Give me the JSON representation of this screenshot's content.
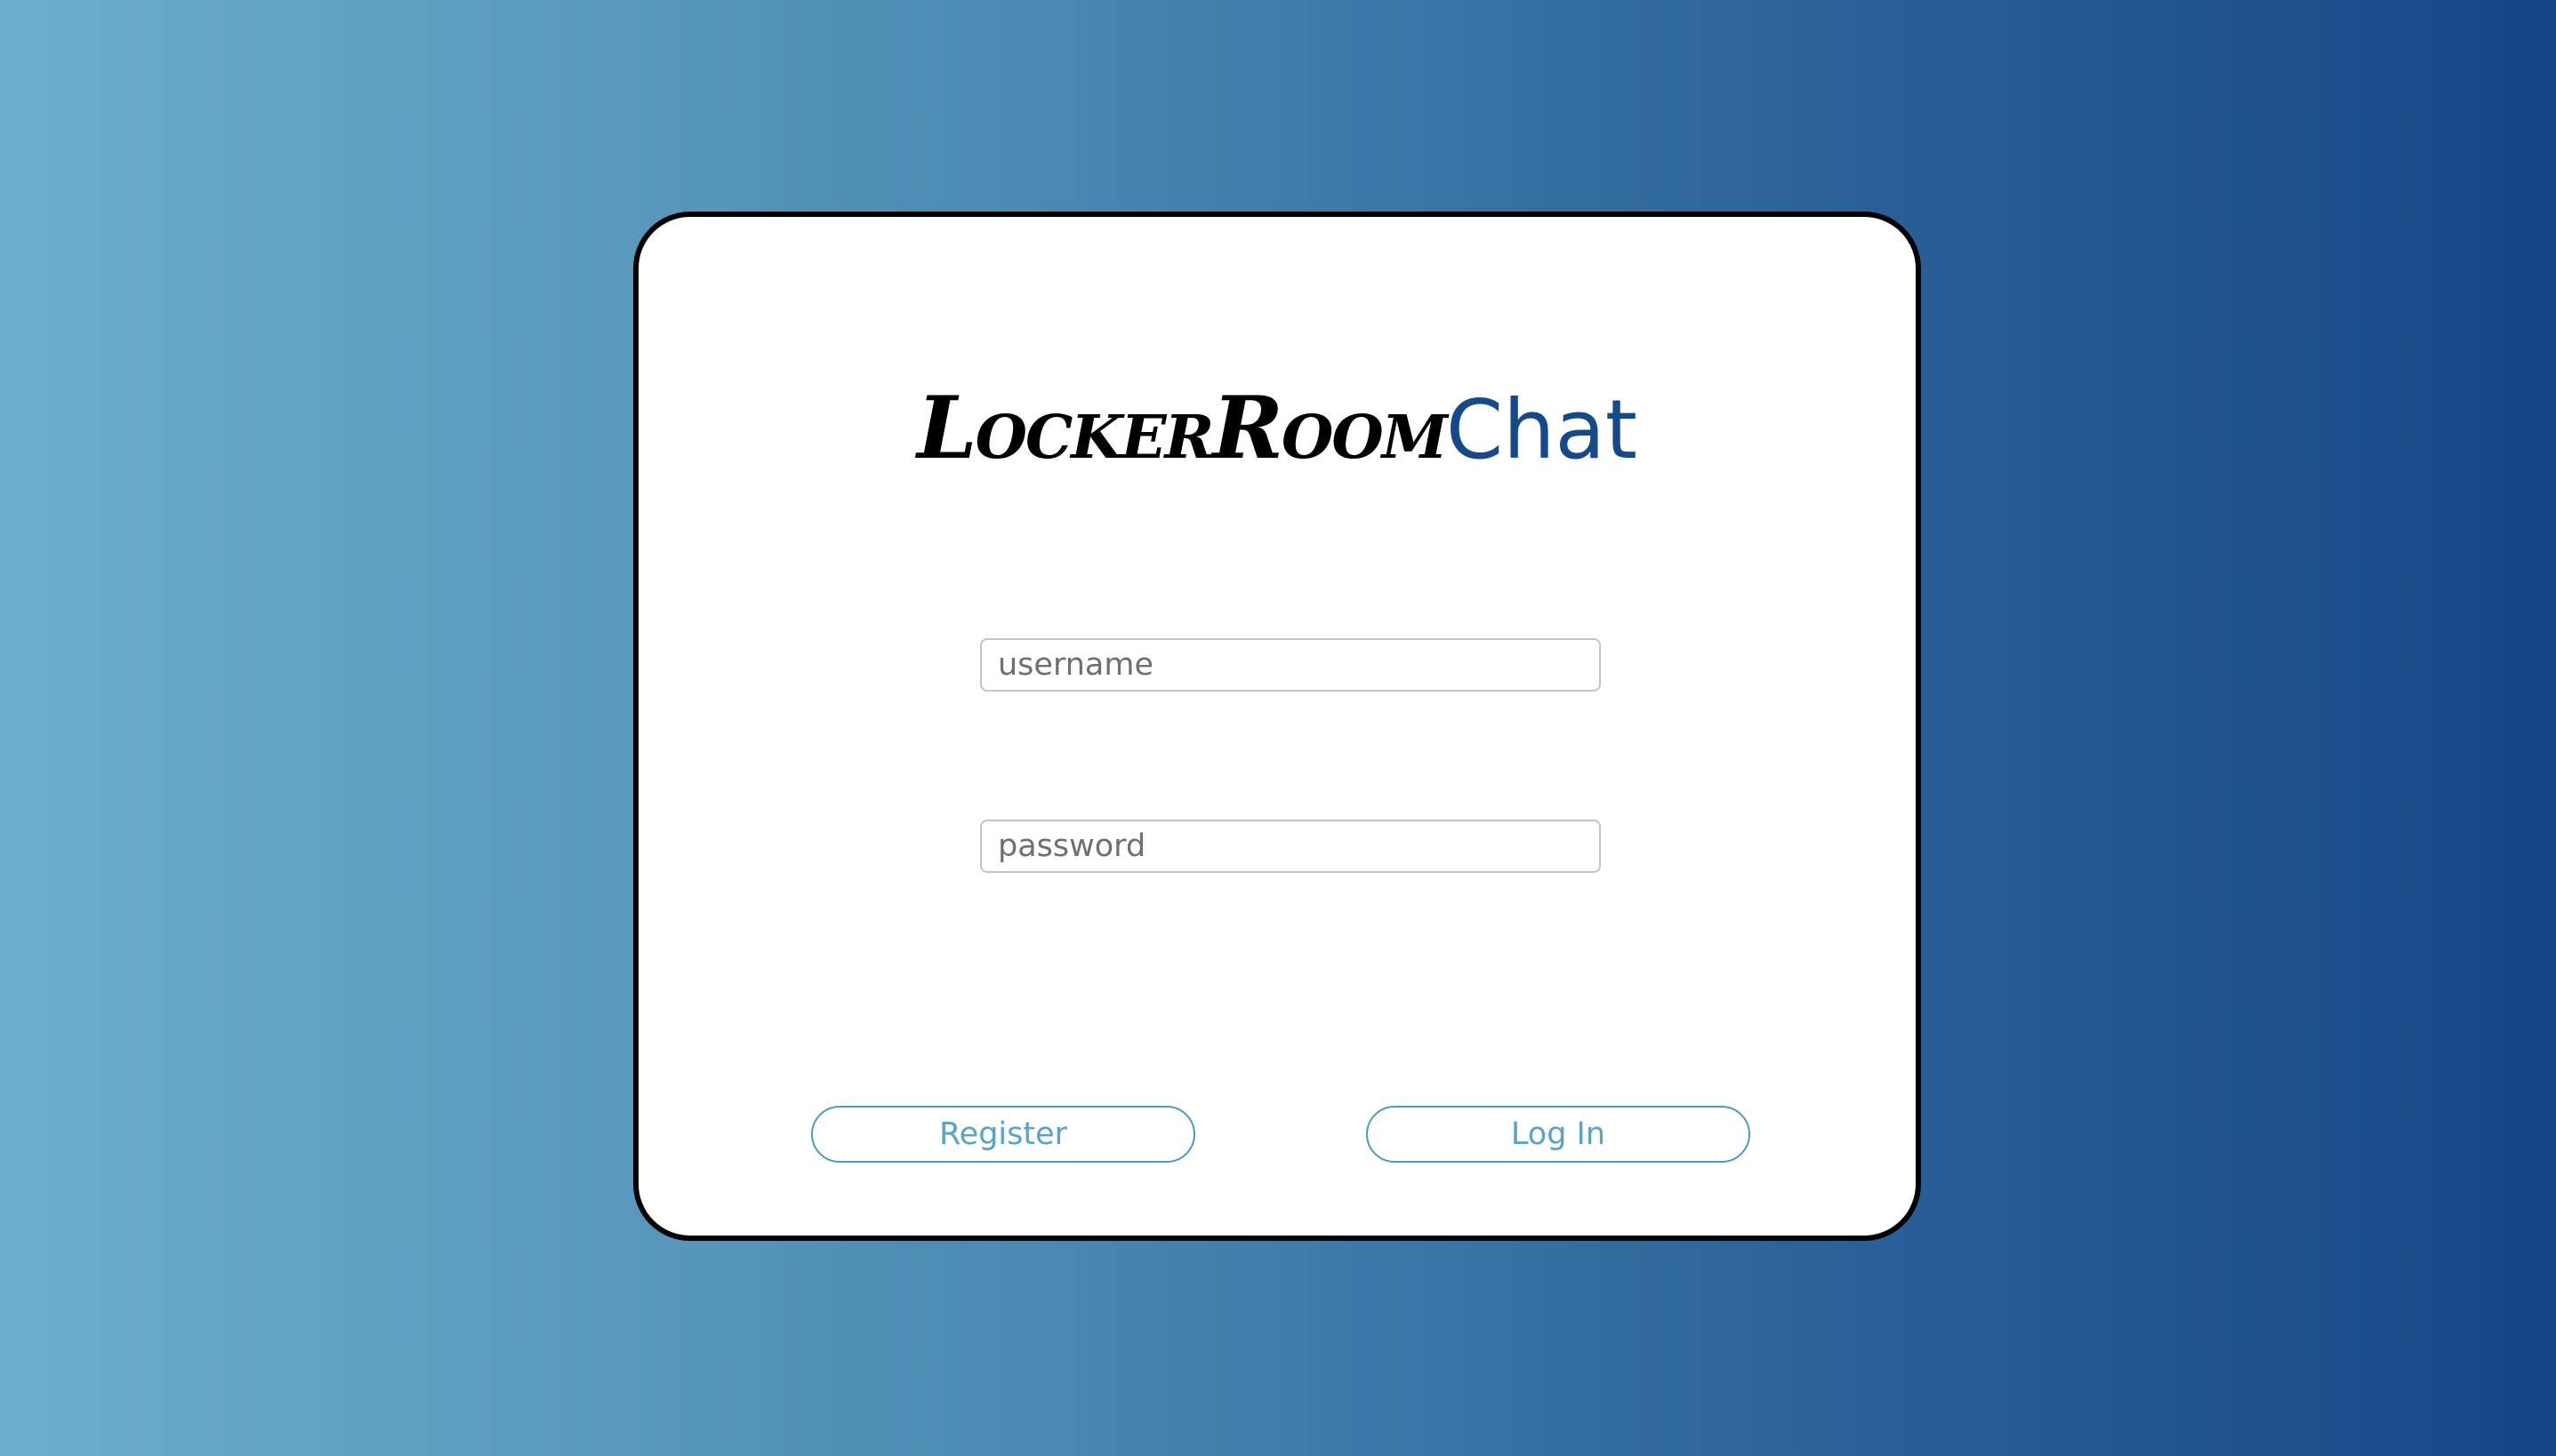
{
  "logo": {
    "part1": "LockerRoom",
    "part2": "Chat"
  },
  "form": {
    "username_placeholder": "username",
    "password_placeholder": "password",
    "username_value": "",
    "password_value": ""
  },
  "buttons": {
    "register_label": "Register",
    "login_label": "Log In"
  },
  "colors": {
    "background_left": "#6cafca",
    "background_right": "#154687",
    "brand_blue": "#15498a",
    "button_accent": "#4a9bc2",
    "card_border": "#000000"
  }
}
